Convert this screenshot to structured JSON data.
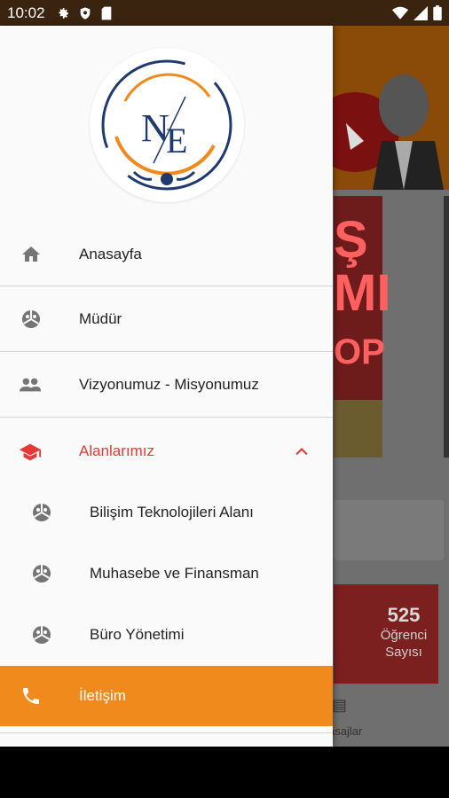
{
  "status_bar": {
    "time": "10:02"
  },
  "drawer": {
    "items": [
      {
        "label": "Anasayfa",
        "icon": "home-icon"
      },
      {
        "label": "Müdür",
        "icon": "pie-icon"
      },
      {
        "label": "Vizyonumuz - Misyonumuz",
        "icon": "people-icon"
      },
      {
        "label": "Alanlarımız",
        "icon": "graduation-cap-icon",
        "color": "#e53935"
      },
      {
        "label": "İletişim",
        "icon": "phone-icon"
      }
    ],
    "sub_items": [
      {
        "label": "Bilişim Teknolojileri Alanı"
      },
      {
        "label": "Muhasebe ve Finansman"
      },
      {
        "label": "Büro Yönetimi"
      }
    ],
    "accent_color": "#f08a1c"
  },
  "background": {
    "stat_value": "525",
    "stat_label": "Öğrenci Sayısı",
    "nav_label": "asajlar"
  }
}
